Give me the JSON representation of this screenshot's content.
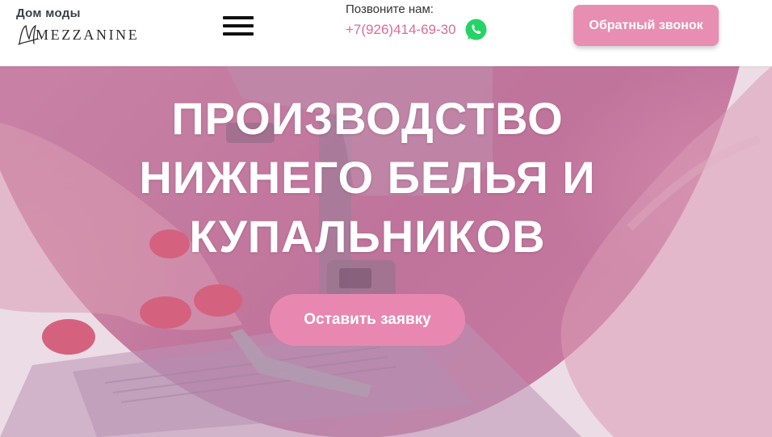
{
  "header": {
    "brand_top": "Дом моды",
    "brand_name": "MEZZANINE",
    "call_label": "Позвоните нам:",
    "phone": "+7(926)414-69-30",
    "whatsapp_icon": "whatsapp-icon",
    "menu_icon": "hamburger-menu-icon",
    "callback_label": "Обратный звонок"
  },
  "hero": {
    "title_lines": [
      "ПРОИЗВОДСТВО",
      "НИЖНЕГО БЕЛЬЯ И",
      "КУПАЛЬНИКОВ"
    ],
    "cta_label": "Оставить заявку",
    "background": "sewing-machine-photo"
  },
  "colors": {
    "accent": "#e888b0",
    "phone": "#d96b98",
    "whatsapp": "#25d366",
    "hero_tint": "#c981a6"
  }
}
